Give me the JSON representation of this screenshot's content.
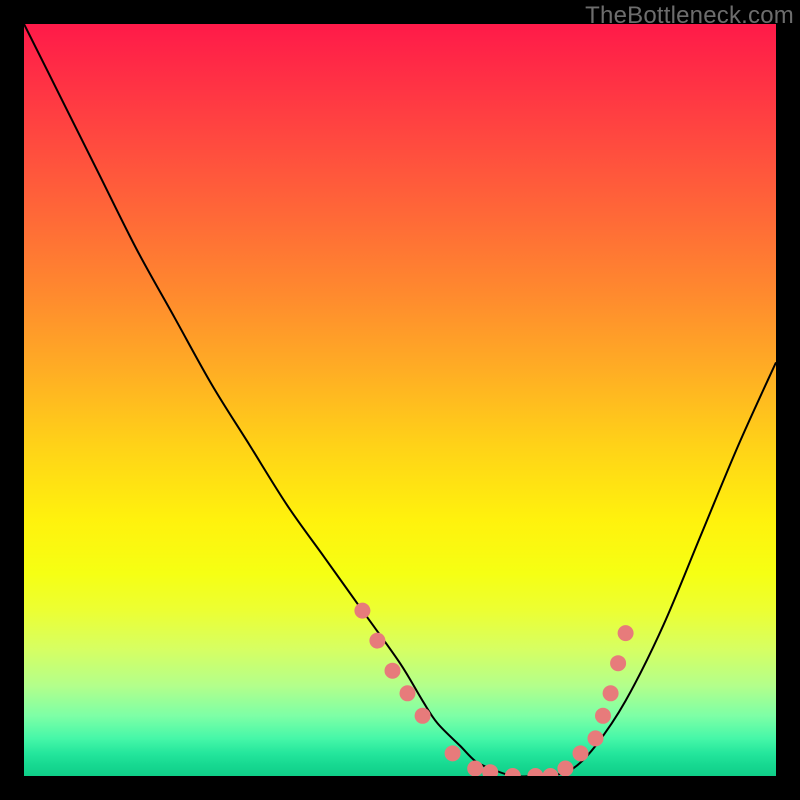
{
  "watermark": "TheBottleneck.com",
  "colors": {
    "background": "#000000",
    "curve_stroke": "#000000",
    "dot_fill": "#e77b7b"
  },
  "chart_data": {
    "type": "line",
    "title": "",
    "xlabel": "",
    "ylabel": "",
    "xlim": [
      0,
      100
    ],
    "ylim": [
      0,
      100
    ],
    "series": [
      {
        "name": "bottleneck-curve",
        "x": [
          0,
          5,
          10,
          15,
          20,
          25,
          30,
          35,
          40,
          45,
          50,
          53,
          55,
          58,
          60,
          62,
          65,
          68,
          70,
          73,
          76,
          80,
          85,
          90,
          95,
          100
        ],
        "y": [
          100,
          90,
          80,
          70,
          61,
          52,
          44,
          36,
          29,
          22,
          15,
          10,
          7,
          4,
          2,
          1,
          0,
          0,
          0,
          1,
          4,
          10,
          20,
          32,
          44,
          55
        ]
      }
    ],
    "highlighted_points": {
      "name": "scatter-dots",
      "x": [
        45,
        47,
        49,
        51,
        53,
        57,
        60,
        62,
        65,
        68,
        70,
        72,
        74,
        76,
        77,
        78,
        79,
        80
      ],
      "y": [
        22,
        18,
        14,
        11,
        8,
        3,
        1,
        0.5,
        0,
        0,
        0,
        1,
        3,
        5,
        8,
        11,
        15,
        19
      ]
    }
  }
}
